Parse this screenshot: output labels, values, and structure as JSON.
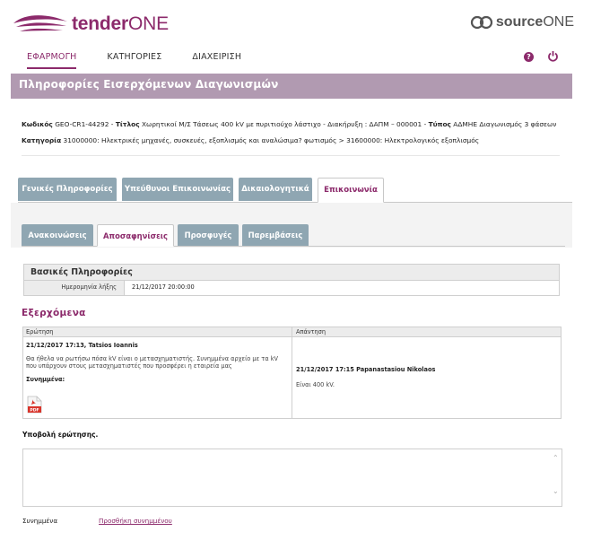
{
  "header": {
    "logo_bold": "tender",
    "logo_regular": "ONE",
    "source_bold": "source",
    "source_regular": "ONE"
  },
  "nav": {
    "items": [
      {
        "label": "ΕΦΑΡΜΟΓΗ",
        "active": true
      },
      {
        "label": "ΚΑΤΗΓΟΡΙΕΣ",
        "active": false
      },
      {
        "label": "ΔΙΑΧΕΙΡΙΣΗ",
        "active": false
      }
    ],
    "help_icon_glyph": "?"
  },
  "page_title": "Πληροφορίες Εισερχόμενων Διαγωνισμών",
  "info": {
    "code_label": "Κωδικός",
    "code_value": "GEO-CR1-44292",
    "title_label": "Τίτλος",
    "title_value": "Χωρητικοί Μ/Σ Τάσεως 400 kV με πυριτιούχο λάστιχο - Διακήρυξη : ΔΑΠΜ – 000001",
    "type_label": "Τύπος",
    "type_value": "ΑΔΜΗΕ Διαγωνισμός 3 φάσεων",
    "category_label": "Κατηγορία",
    "category_value": "31000000: Ηλεκτρικές μηχανές, συσκευές, εξοπλισμός και αναλώσιμα? φωτισμός > 31600000: Ηλεκτρολογικός εξοπλισμός"
  },
  "main_tabs": [
    {
      "label": "Γενικές Πληροφορίες",
      "active": false
    },
    {
      "label": "Υπεύθυνοι Επικοινωνίας",
      "active": false
    },
    {
      "label": "Δικαιολογητικά",
      "active": false
    },
    {
      "label": "Επικοινωνία",
      "active": true
    }
  ],
  "sub_tabs": [
    {
      "label": "Ανακοινώσεις",
      "active": false
    },
    {
      "label": "Αποσαφηνίσεις",
      "active": true
    },
    {
      "label": "Προσφυγές",
      "active": false
    },
    {
      "label": "Παρεμβάσεις",
      "active": false
    }
  ],
  "basic_info": {
    "heading": "Βασικές Πληροφορίες",
    "expiry_label": "Ημερομηνία λήξης",
    "expiry_value": "21/12/2017 20:00:00"
  },
  "incoming": {
    "heading": "Εξερχόμενα",
    "col_question": "Ερώτηση",
    "col_answer": "Απάντηση",
    "question_author": "21/12/2017 17:13, Tatsios Ioannis",
    "question_text": "Θα ήθελα να ρωτήσω πόσα kV είναι ο μετασχηματιστής. Συνημμένα αρχείο με τα kV που υπάρχουν στους μετασχηματιστές που προσφέρει η εταιρεία μας",
    "attachments_label": "Συνημμένα:",
    "pdf_icon_text": "PDF",
    "answer_author": "21/12/2017 17:15 Papanastasiou Nikolaos",
    "answer_text": "Είναι 400 kV."
  },
  "submit": {
    "heading": "Υποβολή ερώτησης.",
    "question_value": "",
    "attachments_label": "Συνημμένα",
    "add_attachment_link": "Προσθήκη συνημμένου"
  },
  "colors": {
    "brand": "#8c2a6b",
    "title_bar": "#b19ab1",
    "tab_inactive": "#8fa6b2"
  }
}
